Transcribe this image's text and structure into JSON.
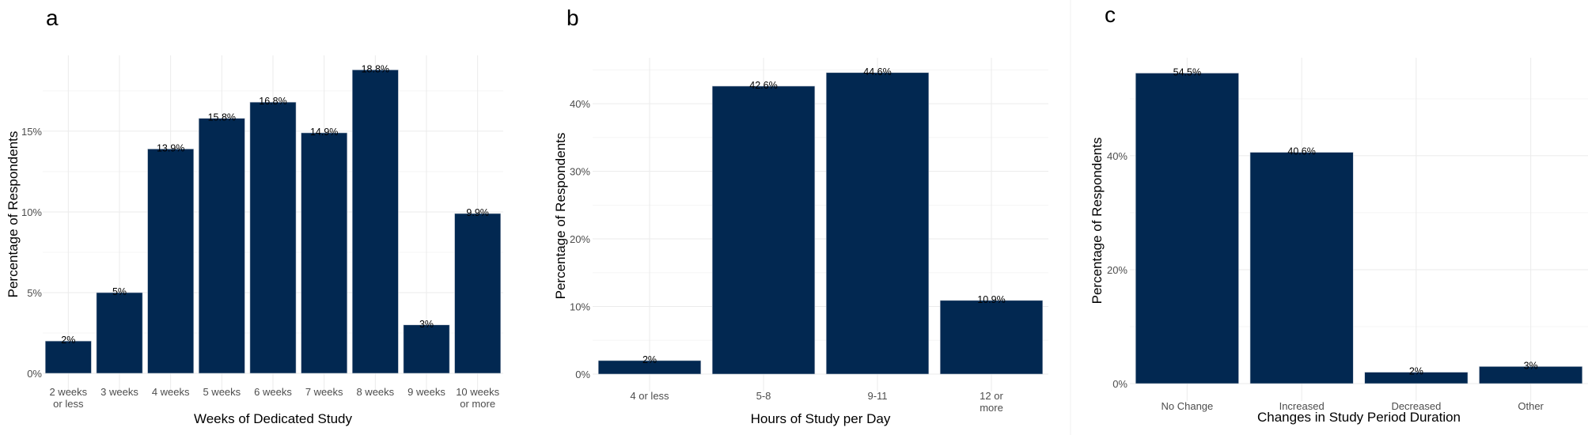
{
  "bar_color": "#022851",
  "chart_data": [
    {
      "type": "bar",
      "panel": "a",
      "title": "",
      "xlabel": "Weeks of Dedicated Study",
      "ylabel": "Percentage of Respondents",
      "categories": [
        [
          "2 weeks",
          "or less"
        ],
        [
          "3 weeks"
        ],
        [
          "4 weeks"
        ],
        [
          "5 weeks"
        ],
        [
          "6 weeks"
        ],
        [
          "7 weeks"
        ],
        [
          "8 weeks"
        ],
        [
          "9 weeks"
        ],
        [
          "10 weeks",
          "or more"
        ]
      ],
      "values": [
        2,
        5,
        13.9,
        15.8,
        16.8,
        14.9,
        18.8,
        3,
        9.9
      ],
      "labels": [
        "2%",
        "5%",
        "13.9%",
        "15.8%",
        "16.8%",
        "14.9%",
        "18.8%",
        "3%",
        "9.9%"
      ],
      "yticks": [
        0,
        5,
        10,
        15
      ],
      "ytick_labels": [
        "0%",
        "5%",
        "10%",
        "15%"
      ],
      "ylim": [
        0,
        19.7
      ],
      "grid": true,
      "legend": "none"
    },
    {
      "type": "bar",
      "panel": "b",
      "title": "",
      "xlabel": "Hours of Study per Day",
      "ylabel": "Percentage of Respondents",
      "categories": [
        [
          "4 or less"
        ],
        [
          "5-8"
        ],
        [
          "9-11"
        ],
        [
          "12 or",
          "more"
        ]
      ],
      "values": [
        2,
        42.6,
        44.6,
        10.9
      ],
      "labels": [
        "2%",
        "42.6%",
        "44.6%",
        "10.9%"
      ],
      "yticks": [
        0,
        10,
        20,
        30,
        40
      ],
      "ytick_labels": [
        "0%",
        "10%",
        "20%",
        "30%",
        "40%"
      ],
      "ylim": [
        0,
        46.8
      ],
      "grid": true,
      "legend": "none"
    },
    {
      "type": "bar",
      "panel": "c",
      "title": "",
      "xlabel": "Changes in Study Period Duration",
      "ylabel": "Percentage of Respondents",
      "categories": [
        [
          "No Change"
        ],
        [
          "Increased"
        ],
        [
          "Decreased"
        ],
        [
          "Other"
        ]
      ],
      "values": [
        54.5,
        40.6,
        2,
        3
      ],
      "labels": [
        "54.5%",
        "40.6%",
        "2%",
        "3%"
      ],
      "yticks": [
        0,
        20,
        40
      ],
      "ytick_labels": [
        "0%",
        "20%",
        "40%"
      ],
      "ylim": [
        0,
        57.2
      ],
      "grid": true,
      "legend": "none"
    }
  ]
}
